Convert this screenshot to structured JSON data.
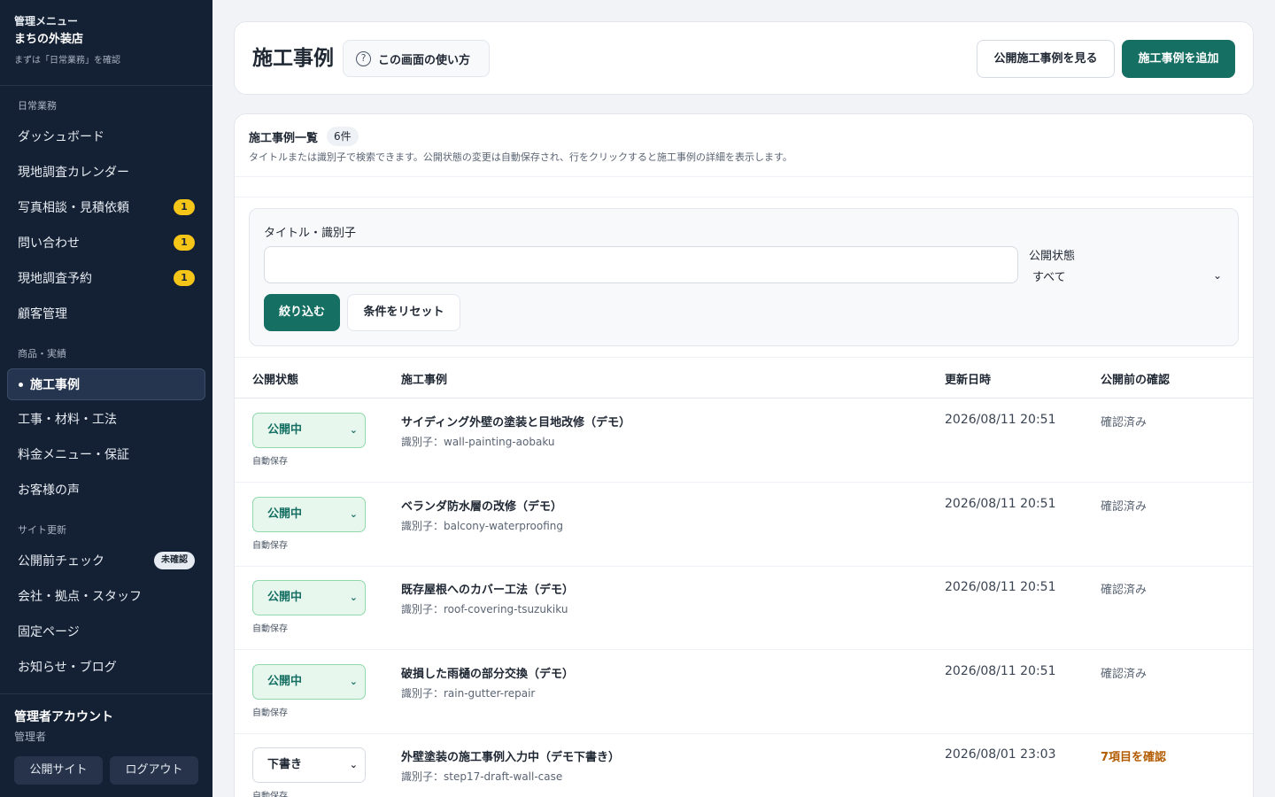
{
  "sidebar": {
    "menu_label": "管理メニュー",
    "shop_name": "まちの外装店",
    "hint": "まずは「日常業務」を確認",
    "sections": {
      "daily": "日常業務",
      "products": "商品・実績",
      "site": "サイト更新"
    },
    "items": [
      {
        "label": "ダッシュボード"
      },
      {
        "label": "現地調査カレンダー"
      },
      {
        "label": "写真相談・見積依頼",
        "badge": "1"
      },
      {
        "label": "問い合わせ",
        "badge": "1"
      },
      {
        "label": "現地調査予約",
        "badge": "1"
      },
      {
        "label": "顧客管理"
      },
      {
        "label": "施工事例"
      },
      {
        "label": "工事・材料・工法"
      },
      {
        "label": "料金メニュー・保証"
      },
      {
        "label": "お客様の声"
      },
      {
        "label": "公開前チェック",
        "pill": "未確認"
      },
      {
        "label": "会社・拠点・スタッフ"
      },
      {
        "label": "固定ページ"
      },
      {
        "label": "お知らせ・ブログ"
      }
    ],
    "account": {
      "name": "管理者アカウント",
      "role": "管理者",
      "public_site": "公開サイト",
      "logout": "ログアウト"
    }
  },
  "header": {
    "title": "施工事例",
    "help_icon": "?",
    "help_label": "この画面の使い方",
    "view_public": "公開施工事例を見る",
    "add": "施工事例を追加"
  },
  "list": {
    "title": "施工事例一覧",
    "count": "6件",
    "description": "タイトルまたは識別子で検索できます。公開状態の変更は自動保存され、行をクリックすると施工事例の詳細を表示します。",
    "filter": {
      "search_label": "タイトル・識別子",
      "search_value": "",
      "status_label": "公開状態",
      "status_value": "すべて",
      "apply": "絞り込む",
      "reset": "条件をリセット"
    },
    "columns": {
      "status": "公開状態",
      "case": "施工事例",
      "updated": "更新日時",
      "check": "公開前の確認"
    },
    "rows": [
      {
        "status": "公開中",
        "autosave": "自動保存",
        "title": "サイディング外壁の塗装と目地改修（デモ）",
        "id": "識別子：wall-painting-aobaku",
        "updated": "2026/08/11 20:51",
        "check": "確認済み"
      },
      {
        "status": "公開中",
        "autosave": "自動保存",
        "title": "ベランダ防水層の改修（デモ）",
        "id": "識別子：balcony-waterproofing",
        "updated": "2026/08/11 20:51",
        "check": "確認済み"
      },
      {
        "status": "公開中",
        "autosave": "自動保存",
        "title": "既存屋根へのカバー工法（デモ）",
        "id": "識別子：roof-covering-tsuzukiku",
        "updated": "2026/08/11 20:51",
        "check": "確認済み"
      },
      {
        "status": "公開中",
        "autosave": "自動保存",
        "title": "破損した雨樋の部分交換（デモ）",
        "id": "識別子：rain-gutter-repair",
        "updated": "2026/08/11 20:51",
        "check": "確認済み"
      },
      {
        "status": "下書き",
        "autosave": "自動保存",
        "title": "外壁塗装の施工事例入力中（デモ下書き）",
        "id": "識別子：step17-draft-wall-case",
        "updated": "2026/08/01 23:03",
        "check": "7項目を確認"
      }
    ]
  },
  "colors": {
    "sidebar_bg": "#142033",
    "primary": "#166f63",
    "badge": "#f5c518",
    "published_bg": "#e8f7ee",
    "warning_text": "#b35c00"
  }
}
